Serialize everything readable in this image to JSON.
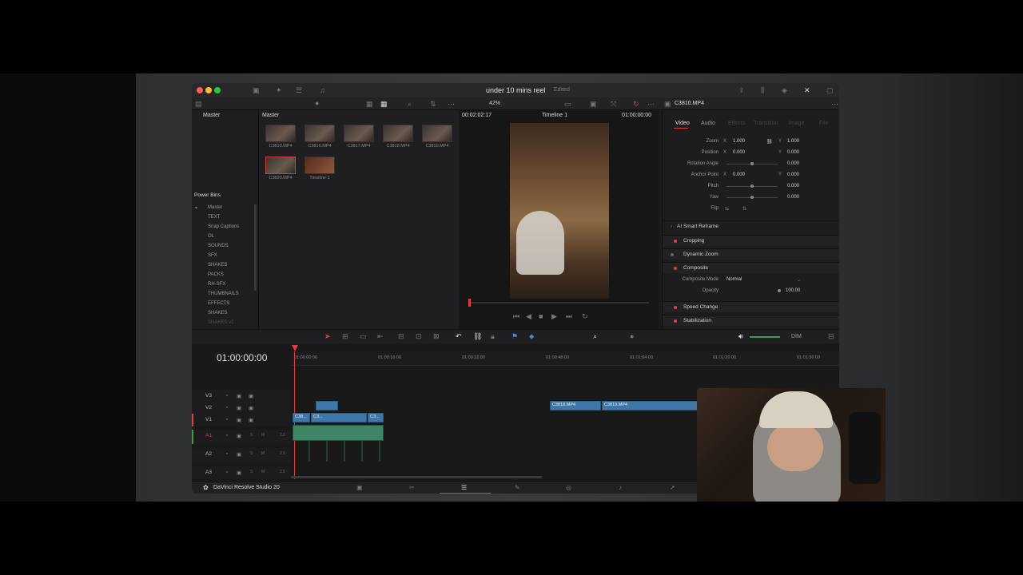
{
  "window": {
    "title": "under 10 mins reel",
    "status": "Edited",
    "app_name": "DaVinci Resolve Studio 20"
  },
  "toolbar": {
    "zoom": "42%",
    "timecode": "00:02:02:17",
    "timeline_name": "Timeline 1",
    "timeline_timecode": "01:00:00:00",
    "clip_name": "C3810.MP4"
  },
  "sidebar": {
    "master": "Master",
    "power_bins": "Power Bins",
    "items": [
      "Master",
      "TEXT",
      "Snap Captions",
      "OL",
      "SOUNDS",
      "SFX",
      "SHAKES",
      "PACKS",
      "RH-SFX",
      "THUMBNAILS",
      "EFFECTS",
      "SHAKES",
      "SHAKES v2"
    ]
  },
  "media_pool": {
    "header": "Master",
    "clips": [
      {
        "label": "C3810.MP4"
      },
      {
        "label": "C3816.MP4"
      },
      {
        "label": "C3817.MP4"
      },
      {
        "label": "C3818.MP4"
      },
      {
        "label": "C3819.MP4"
      },
      {
        "label": "C3820.MP4"
      },
      {
        "label": "Timeline 1"
      }
    ]
  },
  "inspector": {
    "tabs": [
      "Video",
      "Audio",
      "Effects",
      "Transition",
      "Image",
      "File"
    ],
    "transform": {
      "zoom_label": "Zoom",
      "zoom_x": "1.000",
      "zoom_y": "1.000",
      "position_label": "Position",
      "position_x": "0.000",
      "position_y": "0.000",
      "rotation_label": "Rotation Angle",
      "rotation": "0.000",
      "anchor_label": "Anchor Point",
      "anchor_x": "0.000",
      "anchor_y": "0.000",
      "pitch_label": "Pitch",
      "pitch": "0.000",
      "yaw_label": "Yaw",
      "yaw": "0.000",
      "flip_label": "Flip",
      "x": "X",
      "y": "Y"
    },
    "sections": {
      "smart_reframe": "AI Smart Reframe",
      "cropping": "Cropping",
      "dynamic_zoom": "Dynamic Zoom",
      "composite": "Composite",
      "composite_mode_label": "Composite Mode",
      "composite_mode": "Normal",
      "opacity_label": "Opacity",
      "opacity": "100.00",
      "speed_change": "Speed Change",
      "stabilization": "Stabilization"
    }
  },
  "timeline": {
    "timecode": "01:00:00:00",
    "dim_label": "DIM",
    "ruler": [
      "01:00:00:00",
      "01:00:16:00",
      "01:00:32:00",
      "01:00:48:00",
      "01:01:04:00",
      "01:01:20:00",
      "01:01:36:00"
    ],
    "tracks": [
      "V3",
      "V2",
      "V1",
      "A1",
      "A2",
      "A3"
    ],
    "audio_level": "2.0",
    "clips": {
      "v1a": "C38...",
      "v1b": "C3...",
      "v1c": "C3...",
      "v2_right_a": "C3818.MP4",
      "v2_right_b": "C3819.MP4"
    }
  },
  "colors": {
    "accent_red": "#e04040",
    "clip_blue": "#3d78a8",
    "audio_green": "#2d6a50"
  }
}
